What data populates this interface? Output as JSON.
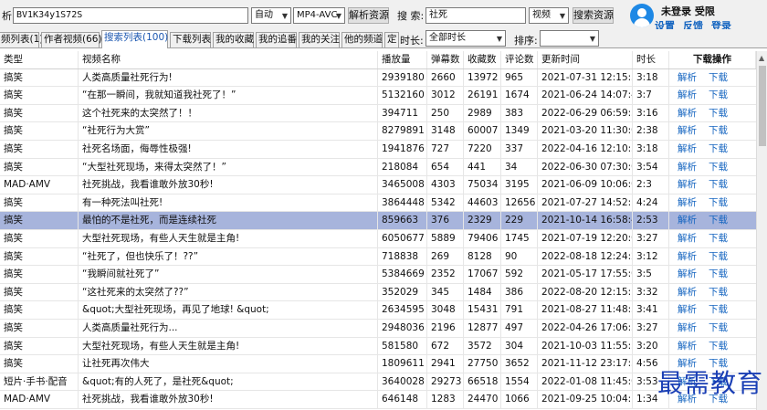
{
  "toolbar": {
    "parse_label": "析:",
    "url_value": "BV1K34y1S72S",
    "mode_value": "自动",
    "format_value": "MP4-AVC",
    "parse_button": "解析资源",
    "search_label": "搜 索:",
    "search_value": "社死",
    "search_type_value": "视频",
    "search_button": "搜索资源"
  },
  "user": {
    "status": "未登录 受限",
    "links": [
      "设置",
      "反馈",
      "登录"
    ]
  },
  "tabs": [
    {
      "label": "频列表(1)"
    },
    {
      "label": "作者视频(66)"
    },
    {
      "label": "搜索列表(100)"
    },
    {
      "label": "下载列表"
    },
    {
      "label": "我的收藏"
    },
    {
      "label": "我的追番"
    },
    {
      "label": "我的关注"
    },
    {
      "label": "他的频道"
    },
    {
      "label": "定"
    }
  ],
  "filters": {
    "duration_label": "时长:",
    "duration_value": "全部时长",
    "sort_label": "排序:",
    "sort_value": ""
  },
  "columns": [
    "类型",
    "视频名称",
    "播放量",
    "弹幕数",
    "收藏数",
    "评论数",
    "更新时间",
    "时长",
    "下载操作"
  ],
  "actions": {
    "parse": "解析",
    "download": "下载"
  },
  "rows": [
    {
      "type": "搞笑",
      "title": "人类高质量社死行为!",
      "plays": "2939180",
      "danmaku": "2660",
      "fav": "13972",
      "comments": "965",
      "time": "2021-07-31 12:15:32",
      "dur": "3:18"
    },
    {
      "type": "搞笑",
      "title": "“在那一瞬间，我就知道我社死了！”",
      "plays": "5132160",
      "danmaku": "3012",
      "fav": "26191",
      "comments": "1674",
      "time": "2021-06-24 14:07:43",
      "dur": "3:7"
    },
    {
      "type": "搞笑",
      "title": "这个社死来的太突然了！！",
      "plays": "394711",
      "danmaku": "250",
      "fav": "2989",
      "comments": "383",
      "time": "2022-06-29 06:59:59",
      "dur": "3:16"
    },
    {
      "type": "搞笑",
      "title": "“社死行为大赏”",
      "plays": "8279891",
      "danmaku": "3148",
      "fav": "60007",
      "comments": "1349",
      "time": "2021-03-20 11:30:03",
      "dur": "2:38"
    },
    {
      "type": "搞笑",
      "title": "社死名场面，侮辱性极强!",
      "plays": "1941876",
      "danmaku": "727",
      "fav": "7220",
      "comments": "337",
      "time": "2022-04-16 12:10:37",
      "dur": "3:18"
    },
    {
      "type": "搞笑",
      "title": "“大型社死现场，来得太突然了！”",
      "plays": "218084",
      "danmaku": "654",
      "fav": "441",
      "comments": "34",
      "time": "2022-06-30 07:30:00",
      "dur": "3:54"
    },
    {
      "type": "MAD·AMV",
      "title": "社死挑战，我看谁敢外放30秒!",
      "plays": "3465008",
      "danmaku": "4303",
      "fav": "75034",
      "comments": "3195",
      "time": "2021-06-09 10:06:09",
      "dur": "2:3"
    },
    {
      "type": "搞笑",
      "title": "有一种死法叫社死!",
      "plays": "3864448",
      "danmaku": "5342",
      "fav": "44603",
      "comments": "12656",
      "time": "2021-07-27 14:52:17",
      "dur": "4:24"
    },
    {
      "type": "搞笑",
      "title": "最怕的不是社死，而是连续社死",
      "plays": "859663",
      "danmaku": "376",
      "fav": "2329",
      "comments": "229",
      "time": "2021-10-14 16:58:45",
      "dur": "2:53"
    },
    {
      "type": "搞笑",
      "title": "大型社死现场，有些人天生就是主角!",
      "plays": "6050677",
      "danmaku": "5889",
      "fav": "79406",
      "comments": "1745",
      "time": "2021-07-19 12:20:05",
      "dur": "3:27"
    },
    {
      "type": "搞笑",
      "title": "“社死了，但也快乐了！??”",
      "plays": "718838",
      "danmaku": "269",
      "fav": "8128",
      "comments": "90",
      "time": "2022-08-18 12:24:22",
      "dur": "3:12"
    },
    {
      "type": "搞笑",
      "title": "“我瞬间就社死了”",
      "plays": "5384669",
      "danmaku": "2352",
      "fav": "17067",
      "comments": "592",
      "time": "2021-05-17 17:55:00",
      "dur": "3:5"
    },
    {
      "type": "搞笑",
      "title": "“这社死来的太突然了??”",
      "plays": "352029",
      "danmaku": "345",
      "fav": "1484",
      "comments": "386",
      "time": "2022-08-20 12:15:14",
      "dur": "3:32"
    },
    {
      "type": "搞笑",
      "title": "&quot;大型社死现场，再见了地球! &quot;",
      "plays": "2634595",
      "danmaku": "3048",
      "fav": "15431",
      "comments": "791",
      "time": "2021-08-27 11:48:32",
      "dur": "3:41"
    },
    {
      "type": "搞笑",
      "title": "人类高质量社死行为...",
      "plays": "2948036",
      "danmaku": "2196",
      "fav": "12877",
      "comments": "497",
      "time": "2022-04-26 17:06:38",
      "dur": "3:27"
    },
    {
      "type": "搞笑",
      "title": "大型社死现场，有些人天生就是主角!",
      "plays": "581580",
      "danmaku": "672",
      "fav": "3572",
      "comments": "304",
      "time": "2021-10-03 11:55:54",
      "dur": "3:20"
    },
    {
      "type": "搞笑",
      "title": "让社死再次伟大",
      "plays": "1809611",
      "danmaku": "2941",
      "fav": "27750",
      "comments": "3652",
      "time": "2021-11-12 23:17:31",
      "dur": "4:56"
    },
    {
      "type": "短片·手书·配音",
      "title": "&quot;有的人死了，是社死&quot;",
      "plays": "3640028",
      "danmaku": "29273",
      "fav": "66518",
      "comments": "1554",
      "time": "2022-01-08 11:45:05",
      "dur": "3:53"
    },
    {
      "type": "MAD·AMV",
      "title": "社死挑战，我看谁敢外放30秒!",
      "plays": "646148",
      "danmaku": "1283",
      "fav": "24470",
      "comments": "1066",
      "time": "2021-09-25 10:04:16",
      "dur": "1:34"
    }
  ],
  "selected_row": 8,
  "watermark": "最需教育"
}
